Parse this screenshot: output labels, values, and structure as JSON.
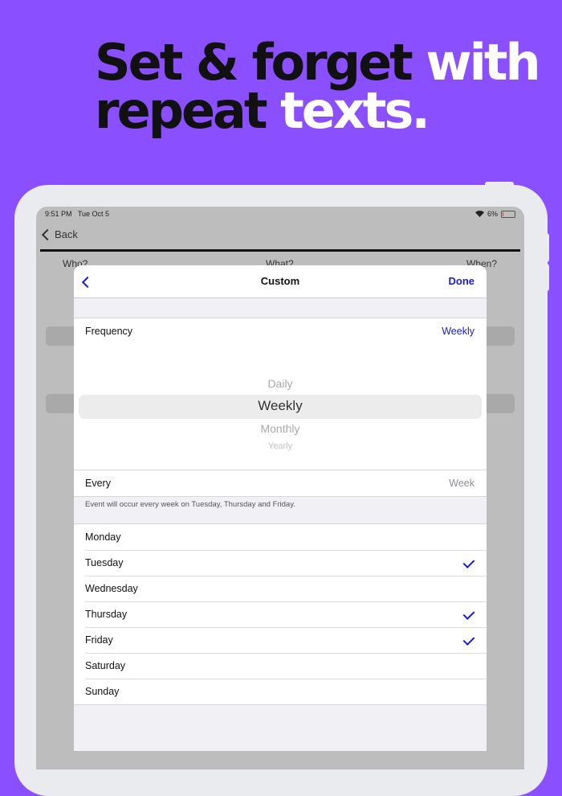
{
  "headline": {
    "part1": "Set & forget ",
    "part2": "with",
    "part3": "repeat ",
    "part4": "texts."
  },
  "status_bar": {
    "time": "9:51 PM",
    "date": "Tue Oct 5",
    "battery": "6%",
    "icons": [
      "wifi-icon",
      "battery-icon"
    ]
  },
  "background_screen": {
    "back_label": "Back",
    "columns": [
      "Who?",
      "What?",
      "When?"
    ]
  },
  "modal": {
    "title": "Custom",
    "done_label": "Done",
    "frequency": {
      "label": "Frequency",
      "value": "Weekly"
    },
    "picker": {
      "options": [
        "Daily",
        "Weekly",
        "Monthly",
        "Yearly"
      ],
      "selected": "Weekly"
    },
    "every": {
      "label": "Every",
      "value": "Week"
    },
    "note": "Event will occur every week on  Tuesday,  Thursday and  Friday.",
    "days": [
      {
        "name": "Monday",
        "checked": false
      },
      {
        "name": "Tuesday",
        "checked": true
      },
      {
        "name": "Wednesday",
        "checked": false
      },
      {
        "name": "Thursday",
        "checked": true
      },
      {
        "name": "Friday",
        "checked": true
      },
      {
        "name": "Saturday",
        "checked": false
      },
      {
        "name": "Sunday",
        "checked": false
      }
    ]
  },
  "colors": {
    "background": "#8a4fff",
    "accent": "#1a1ad6"
  }
}
